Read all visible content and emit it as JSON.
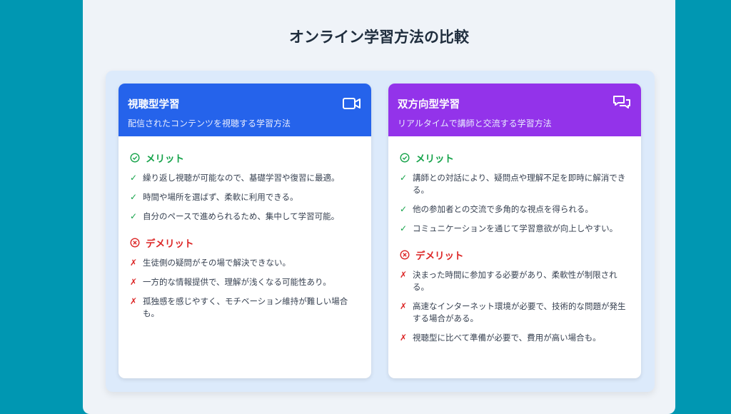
{
  "title": "オンライン学習方法の比較",
  "cards": [
    {
      "title": "視聴型学習",
      "subtitle": "配信されたコンテンツを視聴する学習方法",
      "icon": "video-camera-icon",
      "color": "#2563eb",
      "merit_label": "メリット",
      "merits": [
        "繰り返し視聴が可能なので、基礎学習や復習に最適。",
        "時間や場所を選ばず、柔軟に利用できる。",
        "自分のペースで進められるため、集中して学習可能。"
      ],
      "demerit_label": "デメリット",
      "demerits": [
        "生徒側の疑問がその場で解決できない。",
        "一方的な情報提供で、理解が浅くなる可能性あり。",
        "孤独感を感じやすく、モチベーション維持が難しい場合も。"
      ]
    },
    {
      "title": "双方向型学習",
      "subtitle": "リアルタイムで講師と交流する学習方法",
      "icon": "chat-bubbles-icon",
      "color": "#9333ea",
      "merit_label": "メリット",
      "merits": [
        "講師との対話により、疑問点や理解不足を即時に解消できる。",
        "他の参加者との交流で多角的な視点を得られる。",
        "コミュニケーションを通じて学習意欲が向上しやすい。"
      ],
      "demerit_label": "デメリット",
      "demerits": [
        "決まった時間に参加する必要があり、柔軟性が制限される。",
        "高速なインターネット環境が必要で、技術的な問題が発生する場合がある。",
        "視聴型に比べて準備が必要で、費用が高い場合も。"
      ]
    }
  ],
  "marks": {
    "check": "✓",
    "cross": "✗"
  },
  "colors": {
    "merit": "#16a34a",
    "demerit": "#dc2626",
    "background": "#0097b2"
  }
}
